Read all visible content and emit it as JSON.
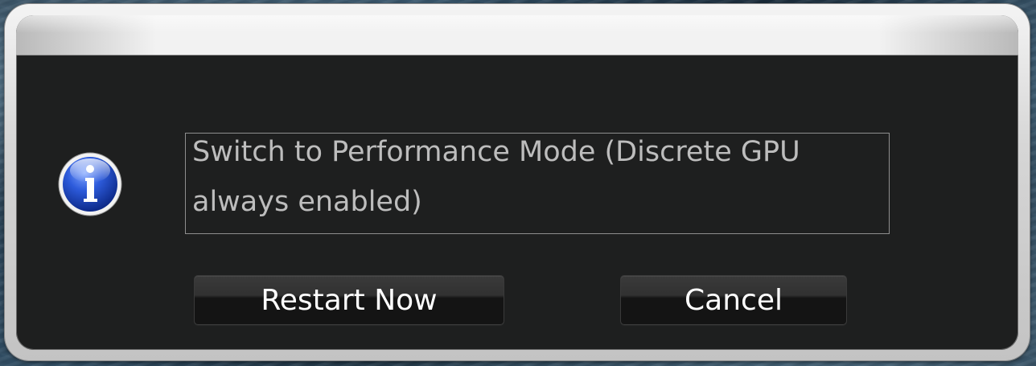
{
  "dialog": {
    "message": "Switch to Performance Mode (Discrete GPU always enabled)",
    "icon": "info-icon",
    "buttons": {
      "restart_label": "Restart Now",
      "cancel_label": "Cancel"
    }
  },
  "colors": {
    "dialog_background": "#1e1f1f",
    "message_text": "#bdbdbd",
    "button_text": "#ffffff",
    "icon_blue": "#1f48c4"
  }
}
